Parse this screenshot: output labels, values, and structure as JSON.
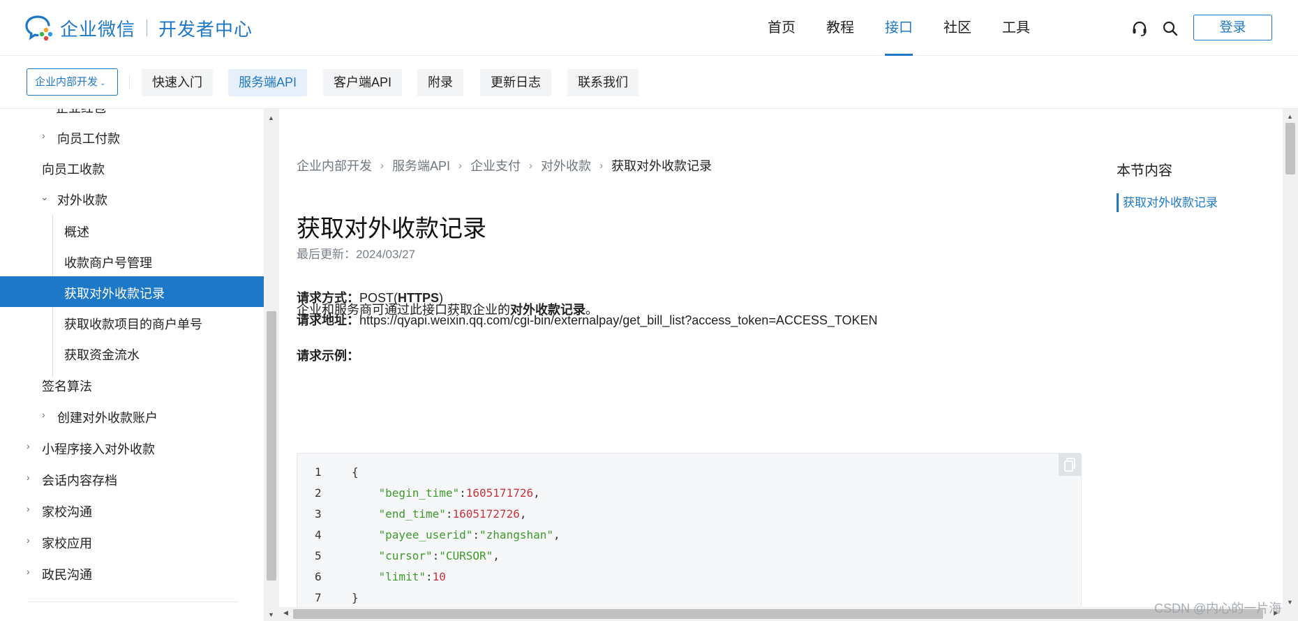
{
  "header": {
    "brand": "企业微信",
    "brand_sub": "开发者中心",
    "nav": [
      {
        "label": "首页",
        "active": false
      },
      {
        "label": "教程",
        "active": false
      },
      {
        "label": "接口",
        "active": true
      },
      {
        "label": "社区",
        "active": false
      },
      {
        "label": "工具",
        "active": false
      }
    ],
    "login_label": "登录",
    "accent_color": "#1e78c8"
  },
  "subnav": {
    "scope_label": "企业内部开发",
    "tabs": [
      {
        "label": "快速入门",
        "active": false
      },
      {
        "label": "服务端API",
        "active": true
      },
      {
        "label": "客户端API",
        "active": false
      },
      {
        "label": "附录",
        "active": false
      },
      {
        "label": "更新日志",
        "active": false
      },
      {
        "label": "联系我们",
        "active": false
      }
    ]
  },
  "sidebar": {
    "items": [
      {
        "label": "企业红包",
        "expandable": true,
        "expanded": false,
        "active": false
      },
      {
        "label": "向员工付款",
        "expandable": true,
        "expanded": false,
        "active": false
      },
      {
        "label": "向员工收款",
        "expandable": false,
        "expanded": false,
        "active": false
      },
      {
        "label": "对外收款",
        "expandable": true,
        "expanded": true,
        "active": false
      },
      {
        "label": "概述",
        "expandable": false,
        "expanded": false,
        "active": false
      },
      {
        "label": "收款商户号管理",
        "expandable": false,
        "expanded": false,
        "active": false
      },
      {
        "label": "获取对外收款记录",
        "expandable": false,
        "expanded": false,
        "active": true
      },
      {
        "label": "获取收款项目的商户单号",
        "expandable": false,
        "expanded": false,
        "active": false
      },
      {
        "label": "获取资金流水",
        "expandable": false,
        "expanded": false,
        "active": false
      },
      {
        "label": "签名算法",
        "expandable": false,
        "expanded": false,
        "active": false
      },
      {
        "label": "创建对外收款账户",
        "expandable": true,
        "expanded": false,
        "active": false
      },
      {
        "label": "小程序接入对外收款",
        "expandable": true,
        "expanded": false,
        "active": false
      },
      {
        "label": "会话内容存档",
        "expandable": true,
        "expanded": false,
        "active": false
      },
      {
        "label": "家校沟通",
        "expandable": true,
        "expanded": false,
        "active": false
      },
      {
        "label": "家校应用",
        "expandable": true,
        "expanded": false,
        "active": false
      },
      {
        "label": "政民沟通",
        "expandable": true,
        "expanded": false,
        "active": false
      }
    ]
  },
  "breadcrumb": [
    "企业内部开发",
    "服务端API",
    "企业支付",
    "对外收款",
    "获取对外收款记录"
  ],
  "article": {
    "title": "获取对外收款记录",
    "updated_label": "最后更新：",
    "updated_date": "2024/03/27",
    "intro_prefix": "企业和服务商可通过此接口获取企业的",
    "intro_bold": "对外收款记录",
    "intro_suffix": "。",
    "method_label": "请求方式：",
    "method_value_prefix": "POST(",
    "method_value_bold": "HTTPS",
    "method_value_suffix": ")",
    "url_label": "请求地址：",
    "url_value": "https://qyapi.weixin.qq.com/cgi-bin/externalpay/get_bill_list?access_token=ACCESS_TOKEN",
    "example_label": "请求示例："
  },
  "code": {
    "lines": [
      {
        "n": "1",
        "indent": "",
        "key": "",
        "sep": "",
        "val": "",
        "val_type": "",
        "tail": "{"
      },
      {
        "n": "2",
        "indent": "    ",
        "key": "\"begin_time\"",
        "sep": ":",
        "val": "1605171726",
        "val_type": "num",
        "tail": ","
      },
      {
        "n": "3",
        "indent": "    ",
        "key": "\"end_time\"",
        "sep": ":",
        "val": "1605172726",
        "val_type": "num",
        "tail": ","
      },
      {
        "n": "4",
        "indent": "    ",
        "key": "\"payee_userid\"",
        "sep": ":",
        "val": "\"zhangshan\"",
        "val_type": "str",
        "tail": ","
      },
      {
        "n": "5",
        "indent": "    ",
        "key": "\"cursor\"",
        "sep": ":",
        "val": "\"CURSOR\"",
        "val_type": "str",
        "tail": ","
      },
      {
        "n": "6",
        "indent": "    ",
        "key": "\"limit\"",
        "sep": ":",
        "val": "10",
        "val_type": "num",
        "tail": ""
      },
      {
        "n": "7",
        "indent": "",
        "key": "",
        "sep": "",
        "val": "",
        "val_type": "",
        "tail": "}"
      }
    ]
  },
  "toc": {
    "title": "本节内容",
    "items": [
      "获取对外收款记录"
    ]
  },
  "watermark": "CSDN @内心的一片海"
}
